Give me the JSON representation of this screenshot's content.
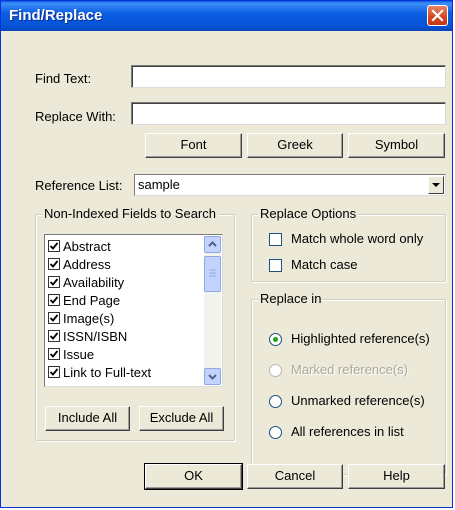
{
  "window": {
    "title": "Find/Replace"
  },
  "find": {
    "label": "Find Text:",
    "value": ""
  },
  "replace": {
    "label": "Replace With:",
    "value": ""
  },
  "buttons": {
    "font": "Font",
    "greek": "Greek",
    "symbol": "Symbol",
    "include_all": "Include All",
    "exclude_all": "Exclude All",
    "ok": "OK",
    "cancel": "Cancel",
    "help": "Help"
  },
  "reference_list": {
    "label": "Reference List:",
    "value": "sample"
  },
  "fields_group": {
    "label": "Non-Indexed Fields to Search",
    "items": [
      {
        "label": "Abstract",
        "checked": true
      },
      {
        "label": "Address",
        "checked": true
      },
      {
        "label": "Availability",
        "checked": true
      },
      {
        "label": "End Page",
        "checked": true
      },
      {
        "label": "Image(s)",
        "checked": true
      },
      {
        "label": "ISSN/ISBN",
        "checked": true
      },
      {
        "label": "Issue",
        "checked": true
      },
      {
        "label": "Link to Full-text",
        "checked": true
      }
    ]
  },
  "replace_options": {
    "label": "Replace Options",
    "match_whole_word": {
      "label": "Match whole word only",
      "checked": false
    },
    "match_case": {
      "label": "Match case",
      "checked": false
    }
  },
  "replace_in": {
    "label": "Replace in",
    "options": [
      {
        "label": "Highlighted reference(s)",
        "selected": true,
        "enabled": true
      },
      {
        "label": "Marked reference(s)",
        "selected": false,
        "enabled": false
      },
      {
        "label": "Unmarked reference(s)",
        "selected": false,
        "enabled": true
      },
      {
        "label": "All references in list",
        "selected": false,
        "enabled": true
      }
    ]
  },
  "colors": {
    "title_bar": "#0552d6",
    "dialog_bg": "#ece9d8",
    "radio_dot": "#21a121"
  }
}
